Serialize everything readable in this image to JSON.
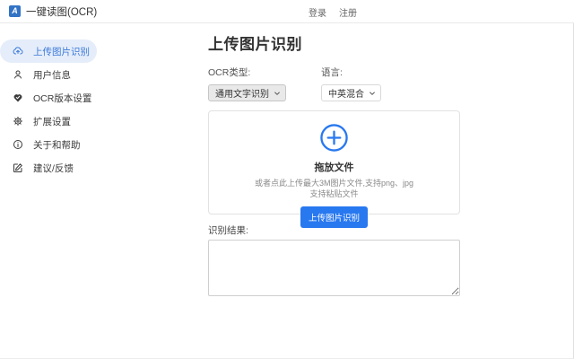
{
  "header": {
    "logo_letter": "A",
    "app_title": "一键读图(OCR)",
    "login_label": "登录",
    "register_label": "注册"
  },
  "sidebar": {
    "items": [
      {
        "label": "上传图片识别",
        "icon": "cloud-upload-icon",
        "active": true
      },
      {
        "label": "用户信息",
        "icon": "user-icon",
        "active": false
      },
      {
        "label": "OCR版本设置",
        "icon": "heart-check-icon",
        "active": false
      },
      {
        "label": "扩展设置",
        "icon": "gear-icon",
        "active": false
      },
      {
        "label": "关于和帮助",
        "icon": "info-icon",
        "active": false
      },
      {
        "label": "建议/反馈",
        "icon": "edit-icon",
        "active": false
      }
    ]
  },
  "main": {
    "title": "上传图片识别",
    "ocr_type": {
      "label": "OCR类型:",
      "value": "通用文字识别"
    },
    "language": {
      "label": "语言:",
      "value": "中英混合"
    },
    "dropzone": {
      "title": "拖放文件",
      "hint_line1": "或者点此上传最大3M图片文件,支持png、jpg",
      "hint_line2": "支持粘贴文件",
      "upload_button": "上传图片识别"
    },
    "result": {
      "label": "识别结果:",
      "value": ""
    }
  },
  "colors": {
    "accent": "#2878f0",
    "active_item_bg": "#e5edfa",
    "active_item_text": "#3b79d9",
    "logo_bg": "#3273c5"
  }
}
